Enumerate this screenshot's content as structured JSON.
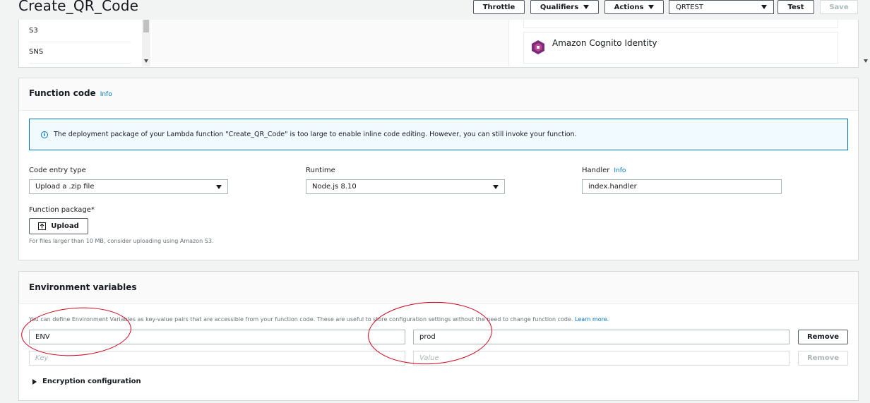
{
  "header": {
    "title": "Create_QR_Code",
    "throttle_label": "Throttle",
    "qualifiers_label": "Qualifiers",
    "actions_label": "Actions",
    "qualifier_value": "QRTEST",
    "test_label": "Test",
    "save_label": "Save"
  },
  "triggers": {
    "items": [
      {
        "label": "S3"
      },
      {
        "label": "SNS"
      }
    ]
  },
  "resources": {
    "cognito_label": "Amazon Cognito Identity",
    "accent": "#7b2a7e"
  },
  "function_code": {
    "title": "Function code",
    "info": "Info",
    "alert_text": "The deployment package of your Lambda function \"Create_QR_Code\" is too large to enable inline code editing. However, you can still invoke your function.",
    "code_entry_label": "Code entry type",
    "code_entry_value": "Upload a .zip file",
    "runtime_label": "Runtime",
    "runtime_value": "Node.js 8.10",
    "handler_label": "Handler",
    "handler_info": "Info",
    "handler_value": "index.handler",
    "package_label": "Function package*",
    "upload_label": "Upload",
    "upload_hint": "For files larger than 10 MB, consider uploading using Amazon S3."
  },
  "env": {
    "title": "Environment variables",
    "description": "You can define Environment Variables as key-value pairs that are accessible from your function code. These are useful to store configuration settings without the need to change function code.",
    "learn_more": "Learn more.",
    "rows": [
      {
        "key": "ENV",
        "value": "prod",
        "remove": "Remove"
      }
    ],
    "key_placeholder": "Key",
    "value_placeholder": "Value",
    "remove_label": "Remove",
    "encryption_label": "Encryption configuration"
  },
  "colors": {
    "link": "#0073bb",
    "annotation": "#d0021b"
  }
}
